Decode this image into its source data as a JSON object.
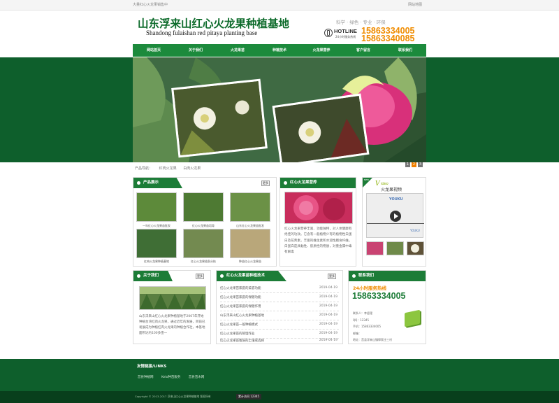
{
  "topbar": {
    "left": "大量红心火龙果销售中",
    "right": "网站地图"
  },
  "header": {
    "title_cn": "山东浮来山红心火龙果种植基地",
    "title_en": "Shandong fulaishan red pitaya planting base",
    "slogan": "科学 · 绿色 · 专业 · 环保",
    "hotline_label": "HOTLINE",
    "hotline_sub": "24小时服务热线",
    "phone1": "15863334005",
    "phone2": "15863340085"
  },
  "nav": [
    "网站首页",
    "关于我们",
    "火龙果苗",
    "种植技术",
    "火龙果营养",
    "客户留言",
    "联系我们"
  ],
  "banner": {
    "dots": [
      "1",
      "2",
      "3"
    ]
  },
  "cats": {
    "label": "产品导航：",
    "items": [
      "红肉火龙果",
      "白肉火龙果"
    ]
  },
  "products": {
    "title": "产品展示",
    "more": "更多",
    "items": [
      "一年红心火龙果苗批发",
      "红心火龙果苗培育",
      "山东红心火龙果苗批发",
      "红肉火龙果种植基地",
      "红心火龙果插条分枝",
      "种苗红心火龙果苗"
    ]
  },
  "nutrition": {
    "title": "红心火龙果营养",
    "text": "红心火龙果营养丰富、功能独特，对人体健康有绝佳的功效。它含有一般植物少有的植物性白蛋白及花青素，丰富的维生素和水溶性膳食纤维。白蛋白是具黏性、胶质性的物质，对重金属中毒有解毒"
  },
  "video": {
    "corner": "NEW",
    "title_en": "ideo",
    "title_cn": "火龙果视频",
    "logo": "YOUKU",
    "logo2": "YOUKU"
  },
  "about": {
    "title": "关于我们",
    "more": "更多",
    "text": "山东浮来山红心火龙果种植基地于2007年开始种植台湾红肉火龙果，通过近年的发展，目前已发展成为种植红肉火龙果的种植合作社，本基地面积达约100多亩一"
  },
  "tech": {
    "title": "红心火龙果苗种植技术",
    "more": "更多",
    "rows": [
      {
        "t": "红心火龙果苗家庭的美容功能",
        "d": "2019-04-19"
      },
      {
        "t": "红心火龙果苗家庭的保健功能",
        "d": "2019-04-19"
      },
      {
        "t": "红心火龙果苗家庭的保健作用",
        "d": "2019-04-19"
      },
      {
        "t": "山东浮来山红心火龙果种植基地",
        "d": "2019-04-19"
      },
      {
        "t": "红心火龙果苗一般种植模式",
        "d": "2019-04-19"
      },
      {
        "t": "红心火龙果苗的管理作业",
        "d": "2019-04-19"
      },
      {
        "t": "红心火龙果苗栽培的土壤或选择",
        "d": "2019-04-19"
      }
    ]
  },
  "contact": {
    "title": "联系我们",
    "hotline_label": "24小时服务热线",
    "phone": "15863334005",
    "lines": [
      "联系人：李经理",
      "QQ：12345",
      "手机：15863334005",
      "邮箱：",
      "地址：莒县浮来山镇郭家庄三村"
    ]
  },
  "links": {
    "title": "友情链接/LINKS",
    "items": [
      "莒县种植网",
      "Kelo种苗服务",
      "莒县苗木网"
    ]
  },
  "footer": {
    "copyright": "Copyright © 2013-2017 浮来山红心火龙果种植基地 版权所有",
    "counter": "累计访问 12345"
  },
  "colors": {
    "green": "#1c7c37",
    "dark_green": "#0e5f2c",
    "orange": "#f08c00"
  }
}
